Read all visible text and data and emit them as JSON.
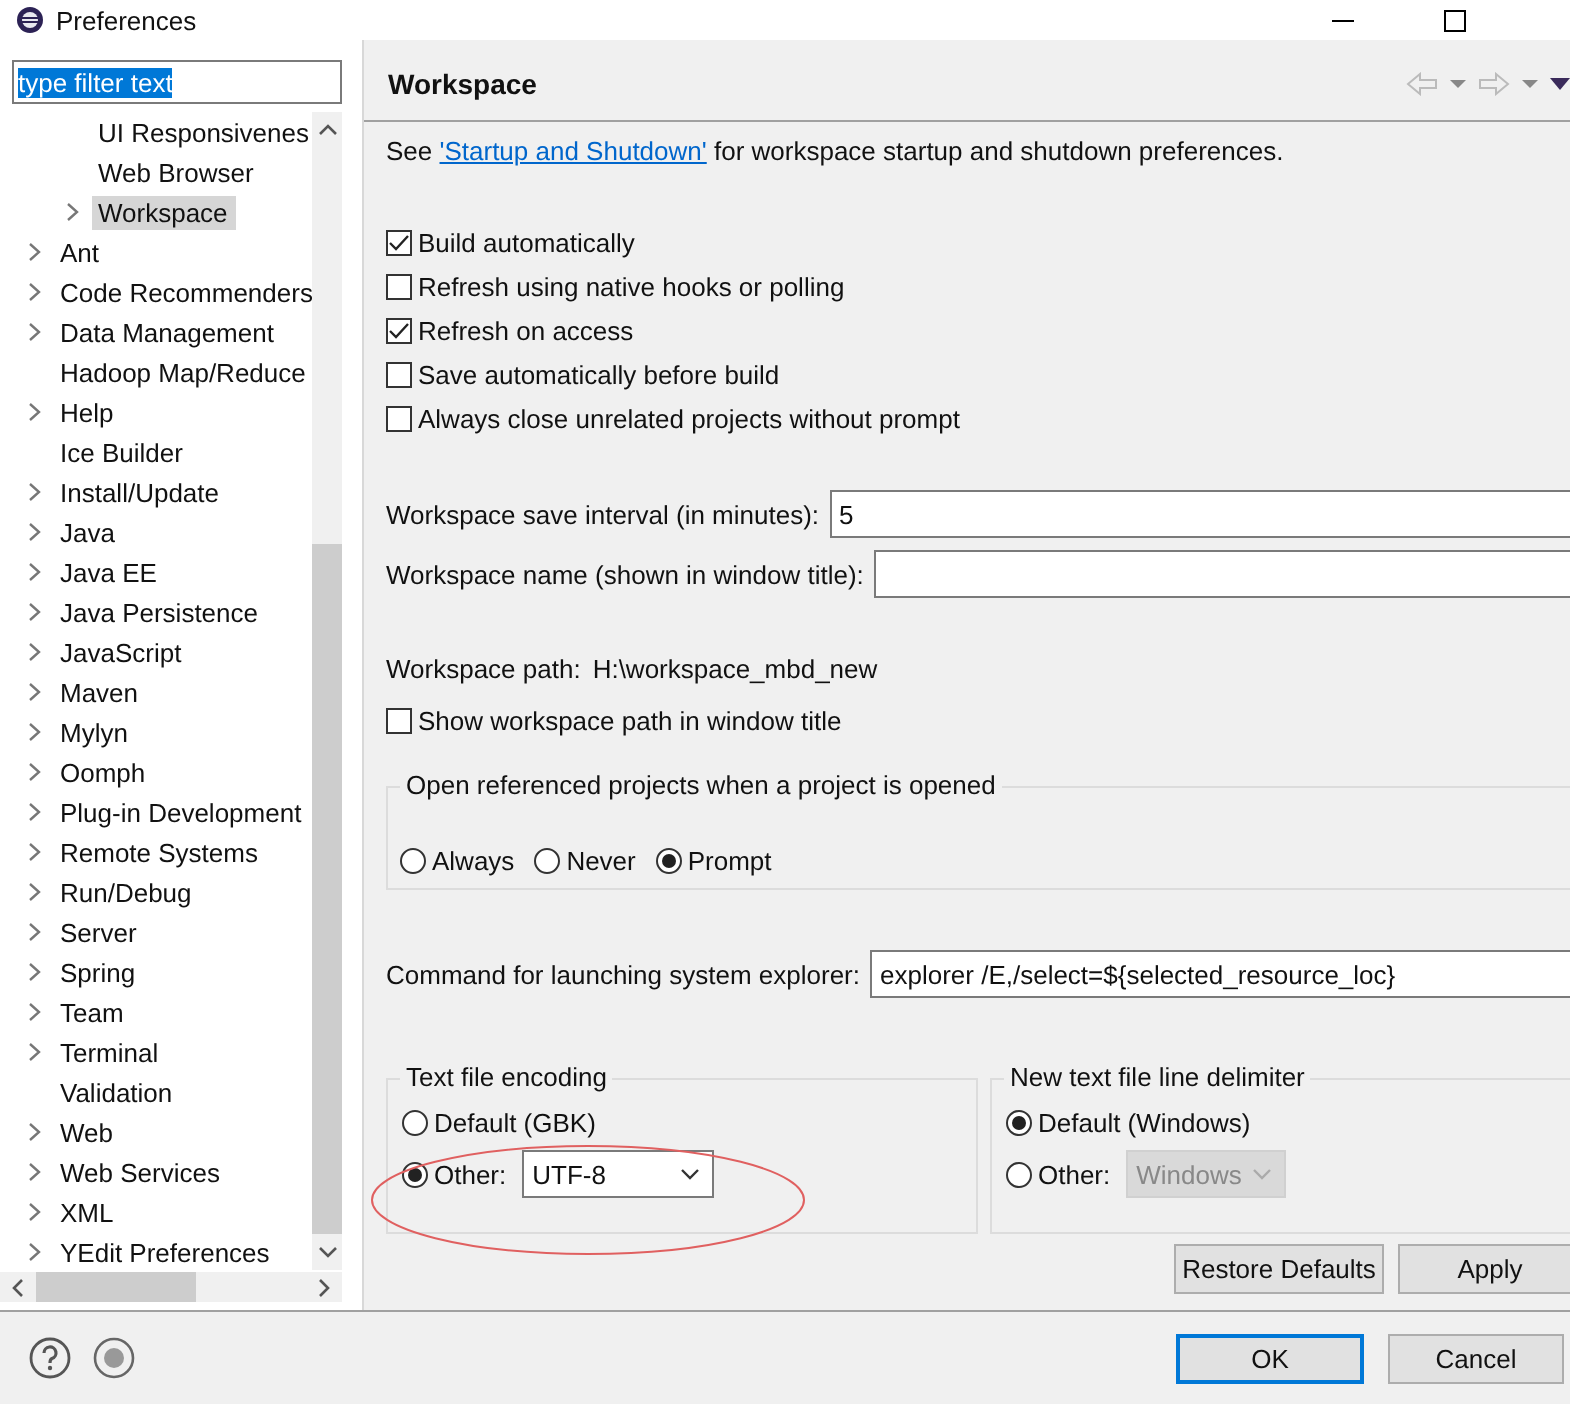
{
  "window": {
    "title": "Preferences"
  },
  "filter": {
    "value": "type filter text",
    "text_selected": true
  },
  "tree": [
    {
      "children": [
        {
          "label": "UI Responsivenes",
          "kind": "leaf",
          "selected": false
        },
        {
          "label": "Web Browser",
          "kind": "leaf",
          "selected": false
        },
        {
          "label": "Workspace",
          "kind": "branch",
          "selected": true
        }
      ]
    },
    {
      "label": "Ant",
      "kind": "branch",
      "selected": false
    },
    {
      "label": "Code Recommenders",
      "kind": "branch",
      "selected": false
    },
    {
      "label": "Data Management",
      "kind": "branch",
      "selected": false
    },
    {
      "label": "Hadoop Map/Reduce",
      "kind": "leaf",
      "selected": false
    },
    {
      "label": "Help",
      "kind": "branch",
      "selected": false
    },
    {
      "label": "Ice Builder",
      "kind": "leaf",
      "selected": false
    },
    {
      "label": "Install/Update",
      "kind": "branch",
      "selected": false
    },
    {
      "label": "Java",
      "kind": "branch",
      "selected": false
    },
    {
      "label": "Java EE",
      "kind": "branch",
      "selected": false
    },
    {
      "label": "Java Persistence",
      "kind": "branch",
      "selected": false
    },
    {
      "label": "JavaScript",
      "kind": "branch",
      "selected": false
    },
    {
      "label": "Maven",
      "kind": "branch",
      "selected": false
    },
    {
      "label": "Mylyn",
      "kind": "branch",
      "selected": false
    },
    {
      "label": "Oomph",
      "kind": "branch",
      "selected": false
    },
    {
      "label": "Plug-in Development",
      "kind": "branch",
      "selected": false
    },
    {
      "label": "Remote Systems",
      "kind": "branch",
      "selected": false
    },
    {
      "label": "Run/Debug",
      "kind": "branch",
      "selected": false
    },
    {
      "label": "Server",
      "kind": "branch",
      "selected": false
    },
    {
      "label": "Spring",
      "kind": "branch",
      "selected": false
    },
    {
      "label": "Team",
      "kind": "branch",
      "selected": false
    },
    {
      "label": "Terminal",
      "kind": "branch",
      "selected": false
    },
    {
      "label": "Validation",
      "kind": "leaf",
      "selected": false
    },
    {
      "label": "Web",
      "kind": "branch",
      "selected": false
    },
    {
      "label": "Web Services",
      "kind": "branch",
      "selected": false
    },
    {
      "label": "XML",
      "kind": "branch",
      "selected": false
    },
    {
      "label": "YEdit Preferences",
      "kind": "branch",
      "selected": false
    }
  ],
  "page": {
    "title": "Workspace",
    "intro": {
      "before": "See",
      "link": "'Startup and Shutdown'",
      "after": "for workspace startup and shutdown preferences."
    },
    "checkboxes": [
      {
        "label": "Build automatically",
        "checked": true
      },
      {
        "label": "Refresh using native hooks or polling",
        "checked": false
      },
      {
        "label": "Refresh on access",
        "checked": true
      },
      {
        "label": "Save automatically before build",
        "checked": false
      },
      {
        "label": "Always close unrelated projects without prompt",
        "checked": false
      }
    ],
    "save_interval": {
      "label": "Workspace save interval (in minutes):",
      "value": "5"
    },
    "workspace_name": {
      "label": "Workspace name (shown in window title):"
    },
    "workspace_path": {
      "label": "Workspace path:",
      "value": "H:\\workspace_mbd_new"
    },
    "show_path": {
      "label": "Show workspace path in window title",
      "checked": false
    },
    "open_referenced": {
      "title": "Open referenced projects when a project is opened",
      "options": [
        {
          "label": "Always",
          "selected": false
        },
        {
          "label": "Never",
          "selected": false
        },
        {
          "label": "Prompt",
          "selected": true
        }
      ]
    },
    "explorer_command": {
      "label": "Command for launching system explorer:",
      "value": "explorer /E,/select=${selected_resource_loc}"
    },
    "encoding": {
      "title": "Text file encoding",
      "options": [
        {
          "label": "Default (GBK)",
          "selected": false
        },
        {
          "label": "Other:",
          "selected": true
        }
      ],
      "combo": {
        "value": "UTF-8",
        "disabled": false
      }
    },
    "delimiter": {
      "title": "New text file line delimiter",
      "options": [
        {
          "label": "Default (Windows)",
          "selected": true
        },
        {
          "label": "Other:",
          "selected": false
        }
      ],
      "combo": {
        "value": "Windows",
        "disabled": true
      }
    },
    "buttons": [
      "Restore Defaults",
      "Apply"
    ]
  },
  "dialog_buttons": [
    {
      "label": "OK",
      "default": true
    },
    {
      "label": "Cancel",
      "default": false
    }
  ]
}
